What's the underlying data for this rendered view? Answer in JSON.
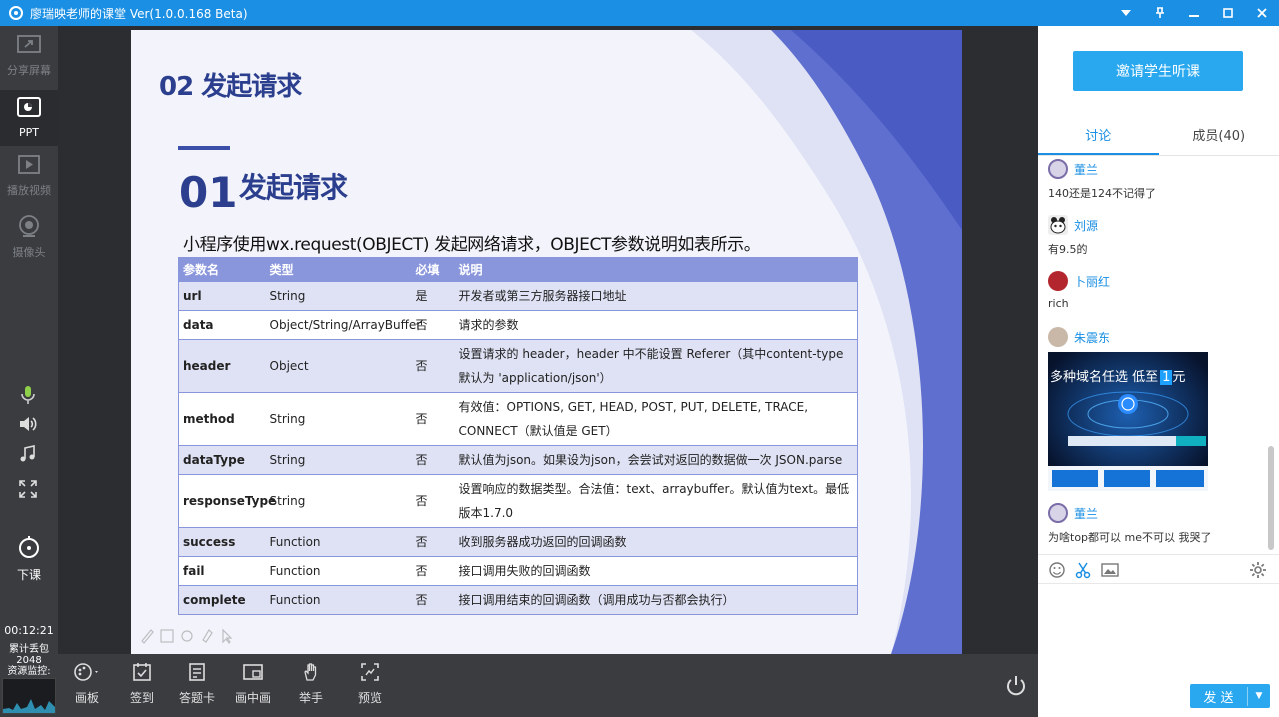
{
  "window": {
    "title": "廖瑞映老师的课堂 Ver(1.0.0.168 Beta)"
  },
  "left_tools": [
    {
      "label": "分享屏幕",
      "icon": "share-screen-icon"
    },
    {
      "label": "PPT",
      "icon": "ppt-icon"
    },
    {
      "label": "播放视频",
      "icon": "play-video-icon"
    },
    {
      "label": "摄像头",
      "icon": "camera-icon"
    },
    {
      "label": "下课",
      "icon": "end-class-icon"
    }
  ],
  "status": {
    "timer": "00:12:21",
    "loss_label": "累计丢包",
    "loss_value": "2048",
    "resource_label": "资源监控:"
  },
  "slide": {
    "section_title": "02 发起请求",
    "sub_number": "01",
    "sub_title": "发起请求",
    "description": "小程序使用wx.request(OBJECT) 发起网络请求，OBJECT参数说明如表所示。",
    "table": {
      "headers": [
        "参数名",
        "类型",
        "必填",
        "说明"
      ],
      "rows": [
        [
          "url",
          "String",
          "是",
          "开发者或第三方服务器接口地址"
        ],
        [
          "data",
          "Object/String/ArrayBuffer",
          "否",
          "请求的参数"
        ],
        [
          "header",
          "Object",
          "否",
          "设置请求的 header，header 中不能设置 Referer（其中content-type 默认为 'application/json'）"
        ],
        [
          "method",
          "String",
          "否",
          "有效值：OPTIONS, GET, HEAD, POST, PUT, DELETE, TRACE, CONNECT（默认值是 GET）"
        ],
        [
          "dataType",
          "String",
          "否",
          "默认值为json。如果设为json，会尝试对返回的数据做一次 JSON.parse"
        ],
        [
          "responseType",
          "String",
          "否",
          "设置响应的数据类型。合法值：text、arraybuffer。默认值为text。最低版本1.7.0"
        ],
        [
          "success",
          "Function",
          "否",
          "收到服务器成功返回的回调函数"
        ],
        [
          "fail",
          "Function",
          "否",
          "接口调用失败的回调函数"
        ],
        [
          "complete",
          "Function",
          "否",
          "接口调用结束的回调函数（调用成功与否都会执行）"
        ]
      ]
    }
  },
  "bottom_tools": [
    {
      "label": "画板",
      "icon": "palette-icon"
    },
    {
      "label": "签到",
      "icon": "sign-in-icon"
    },
    {
      "label": "答题卡",
      "icon": "answer-card-icon"
    },
    {
      "label": "画中画",
      "icon": "picture-in-picture-icon"
    },
    {
      "label": "举手",
      "icon": "raise-hand-icon"
    },
    {
      "label": "预览",
      "icon": "preview-icon"
    }
  ],
  "right": {
    "invite_label": "邀请学生听课",
    "tabs": [
      "讨论",
      "成员(40)"
    ],
    "messages": [
      {
        "name": "董兰",
        "text": "140还是124不记得了"
      },
      {
        "name": "刘源",
        "text": "有9.5的"
      },
      {
        "name": "卜丽红",
        "text": "rich"
      },
      {
        "name": "朱震东",
        "text": ""
      },
      {
        "name": "董兰",
        "text": "为啥top都可以 me不可以 我哭了"
      }
    ],
    "ad": {
      "headline": "多种域名任选  低至",
      "price": "1",
      "unit": "元"
    },
    "send_label": "发 送"
  },
  "colors": {
    "titlebar": "#1a8fe3",
    "accent": "#29a8f0",
    "slide_heading": "#2b3f8e",
    "table_header": "#8a96dc"
  }
}
